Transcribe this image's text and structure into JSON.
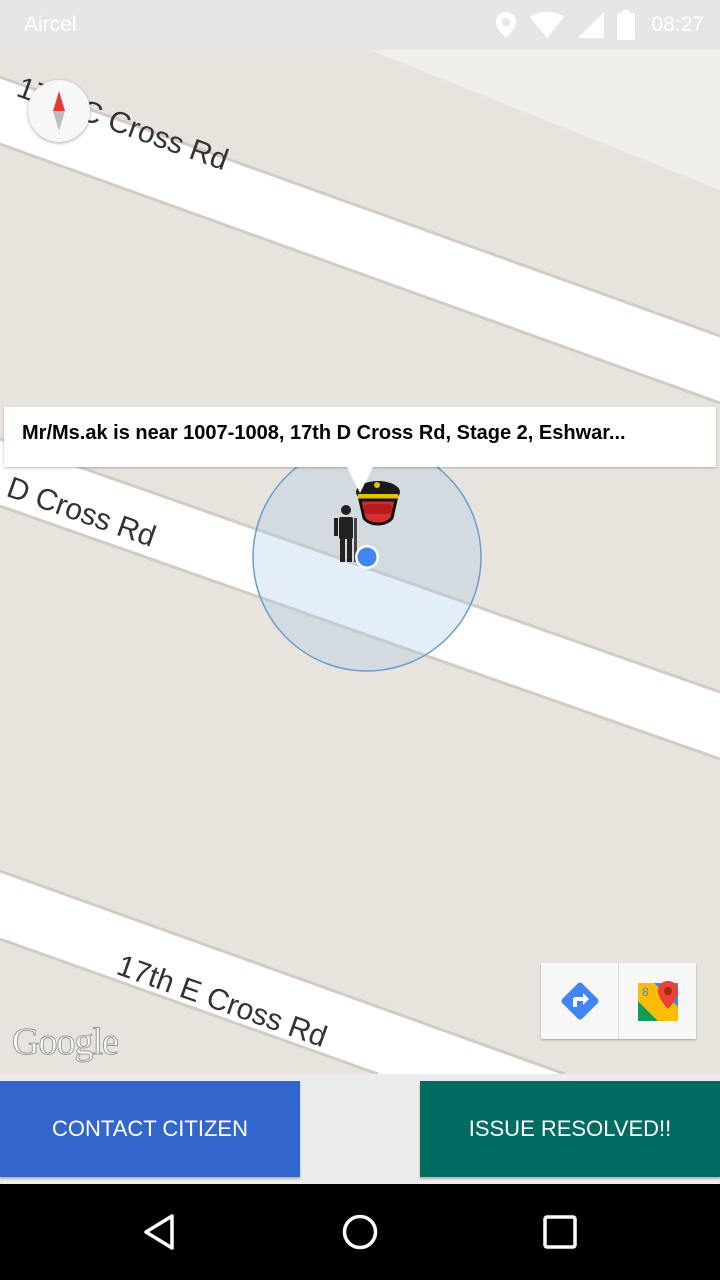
{
  "status_bar": {
    "carrier": "Aircel",
    "time": "08:27",
    "icons": [
      "location-icon",
      "wifi-icon",
      "signal-icon",
      "battery-icon"
    ]
  },
  "map": {
    "roads": [
      "17th C Cross Rd",
      "17th D Cross Rd",
      "17th E Cross Rd"
    ],
    "road_labels_visible": [
      "17th C Cross Rd",
      "D Cross Rd",
      "17th E Cross Rd"
    ],
    "callout": "Mr/Ms.ak is near 1007-1008, 17th D Cross Rd, Stage 2, Eshwar...",
    "attribution": "Google",
    "buttons": [
      "directions-icon",
      "google-maps-icon"
    ]
  },
  "actions": {
    "contact": "CONTACT CITIZEN",
    "resolved": "ISSUE RESOLVED!!"
  },
  "nav": [
    "back-icon",
    "home-icon",
    "recents-icon"
  ],
  "colors": {
    "contact_button": "#3366cc",
    "resolved_button": "#006b63",
    "location_dot": "#4285f4"
  }
}
